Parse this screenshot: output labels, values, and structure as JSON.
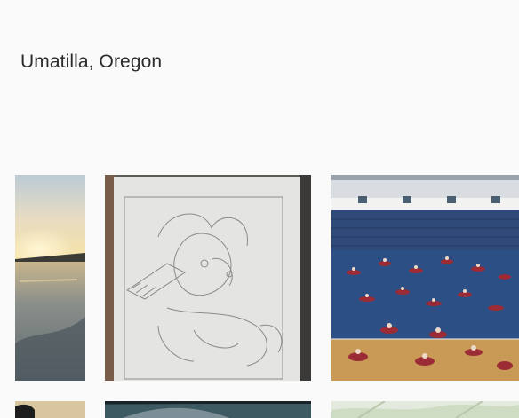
{
  "location": {
    "title": "Umatilla, Oregon"
  },
  "photos": [
    {
      "icon": "sunset-lake-photo"
    },
    {
      "icon": "pencil-sketch-photo"
    },
    {
      "icon": "gym-cheer-practice-photo"
    },
    {
      "icon": "partial-photo-dark"
    },
    {
      "icon": "partial-photo-car"
    },
    {
      "icon": "partial-photo-map"
    }
  ]
}
